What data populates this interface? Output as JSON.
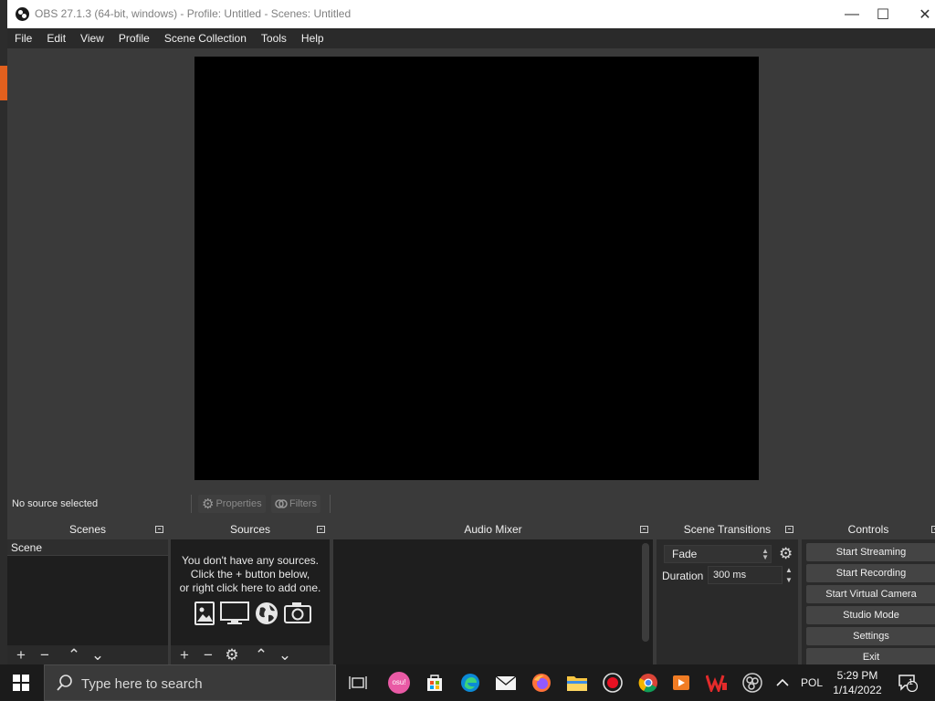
{
  "window": {
    "title": "OBS 27.1.3 (64-bit, windows) - Profile: Untitled - Scenes: Untitled",
    "minimize_glyph": "—",
    "maximize_glyph": "☐",
    "close_glyph": "✕"
  },
  "menu": [
    "File",
    "Edit",
    "View",
    "Profile",
    "Scene Collection",
    "Tools",
    "Help"
  ],
  "source_bar": {
    "no_selection": "No source selected",
    "properties_label": "Properties",
    "filters_label": "Filters"
  },
  "docks": {
    "scenes": {
      "title": "Scenes",
      "items": [
        "Scene"
      ]
    },
    "sources": {
      "title": "Sources",
      "empty_lines": [
        "You don't have any sources.",
        "Click the + button below,",
        "or right click here to add one."
      ]
    },
    "audio_mixer": {
      "title": "Audio Mixer"
    },
    "scene_transitions": {
      "title": "Scene Transitions",
      "selected": "Fade",
      "duration_label": "Duration",
      "duration_value": "300 ms"
    },
    "controls": {
      "title": "Controls",
      "buttons": [
        "Start Streaming",
        "Start Recording",
        "Start Virtual Camera",
        "Studio Mode",
        "Settings",
        "Exit"
      ]
    }
  },
  "glyphs": {
    "plus": "+",
    "minus": "−",
    "up": "⌃",
    "down": "⌄",
    "gear": "⚙"
  },
  "taskbar": {
    "search_placeholder": "Type here to search",
    "osu_label": "osu!",
    "language": "POL",
    "time": "5:29 PM",
    "date": "1/14/2022",
    "notification_count": "1"
  },
  "colors": {
    "accent": "#e2601e",
    "panel": "#2a2a2a",
    "dock_header": "#3a3a3a",
    "preview": "#000000",
    "taskbar": "#1b1b1b"
  }
}
